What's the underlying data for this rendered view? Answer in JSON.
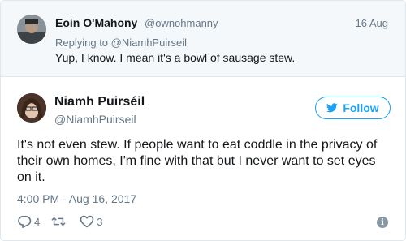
{
  "parent_tweet": {
    "author_name": "Eoin O'Mahony",
    "author_handle": "@ownohmanny",
    "date": "16 Aug",
    "replying_label": "Replying to",
    "replying_handle": "@NiamhPuirseil",
    "text": "Yup, I know. I mean it's a bowl of sausage stew."
  },
  "tweet": {
    "author_name": "Niamh Puirséil",
    "author_handle": "@NiamhPuirseil",
    "follow_label": "Follow",
    "text": "It's not even stew. If people want to eat coddle in the privacy of their own homes, I'm fine with that but I never want to set eyes on it.",
    "timestamp": "4:00 PM - Aug 16, 2017",
    "reply_count": "4",
    "retweet_count": "",
    "like_count": "3"
  },
  "icons": {
    "follow": "twitter-bird-icon",
    "reply": "reply-icon",
    "retweet": "retweet-icon",
    "like": "heart-icon",
    "info": "info-icon"
  },
  "colors": {
    "accent": "#1da1f2",
    "muted": "#657786",
    "text": "#14171a",
    "parent_bg": "#f5f8fa"
  }
}
